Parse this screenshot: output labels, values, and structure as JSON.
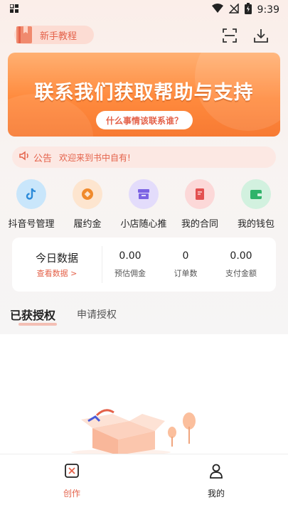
{
  "status_bar": {
    "time": "9:39",
    "icons": [
      "grid-icon",
      "wifi-icon",
      "signal-off-icon",
      "battery-charging-icon"
    ]
  },
  "header": {
    "tutorial_label": "新手教程",
    "icons": [
      "scan-icon",
      "download-icon"
    ]
  },
  "banner": {
    "title": "联系我们获取帮助与支持",
    "pill": "什么事情该联系谁？"
  },
  "notice": {
    "tag": "公告",
    "text": "欢迎来到书中自有!"
  },
  "shortcuts": [
    {
      "label": "抖音号管理",
      "icon": "tiktok-icon",
      "color": "#c9e6fb",
      "fg": "#2b8ad9"
    },
    {
      "label": "履约金",
      "icon": "coin-icon",
      "color": "#fde5cf",
      "fg": "#f08a2c"
    },
    {
      "label": "小店随心推",
      "icon": "shop-icon",
      "color": "#e3dcfb",
      "fg": "#7b63e3"
    },
    {
      "label": "我的合同",
      "icon": "contract-icon",
      "color": "#fcd8d8",
      "fg": "#e35050"
    },
    {
      "label": "我的钱包",
      "icon": "wallet-icon",
      "color": "#d2f1df",
      "fg": "#2fb36a"
    }
  ],
  "stats": {
    "title": "今日数据",
    "link": "查看数据 >",
    "items": [
      {
        "value": "0.00",
        "label": "预估佣金"
      },
      {
        "value": "0",
        "label": "订单数"
      },
      {
        "value": "0.00",
        "label": "支付金额"
      }
    ]
  },
  "tabs": {
    "active": "已获授权",
    "inactive": "申请授权"
  },
  "bottom_nav": [
    {
      "label": "创作",
      "icon": "create-icon",
      "active": true,
      "color": "#e4624a"
    },
    {
      "label": "我的",
      "icon": "profile-icon",
      "active": false,
      "color": "#222222"
    }
  ],
  "colors": {
    "accent": "#e4624a",
    "banner": "#ff8a3d"
  }
}
